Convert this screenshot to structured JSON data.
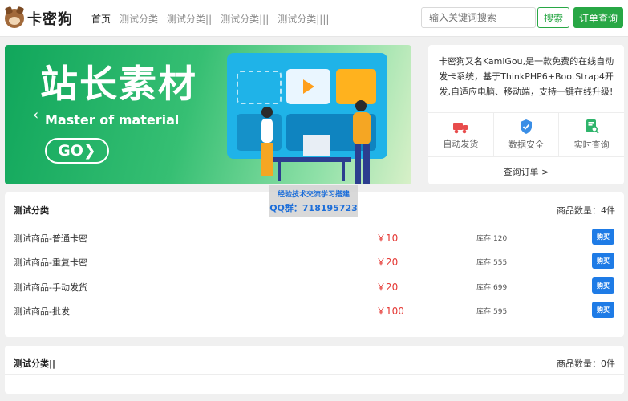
{
  "header": {
    "logo_text": "卡密狗",
    "nav": [
      {
        "label": "首页",
        "active": true
      },
      {
        "label": "测试分类",
        "active": false
      },
      {
        "label": "测试分类||",
        "active": false
      },
      {
        "label": "测试分类|||",
        "active": false
      },
      {
        "label": "测试分类||||",
        "active": false
      }
    ],
    "search_placeholder": "输入关键词搜索",
    "search_label": "搜索",
    "order_label": "订单查询"
  },
  "banner": {
    "title": "站长素材",
    "subtitle": "Master of material",
    "go_label": "GO",
    "prev_icon": "chevron-left-icon",
    "next_icon": "chevron-right-icon"
  },
  "side": {
    "description": "卡密狗又名KamiGou,是一款免费的在线自动发卡系统，基于ThinkPHP6+BootStrap4开发,自适应电脑、移动端，支持一键在线升级!",
    "features": [
      {
        "label": "自动发货",
        "icon": "truck-icon",
        "color": "#e84c4c"
      },
      {
        "label": "数据安全",
        "icon": "shield-icon",
        "color": "#3a8ee6"
      },
      {
        "label": "实时查询",
        "icon": "search-doc-icon",
        "color": "#2fb46b"
      }
    ],
    "query_link": "查询订单 >"
  },
  "categories": [
    {
      "title": "测试分类",
      "count_label": "商品数量：4件",
      "products": [
        {
          "name": "测试商品-普通卡密",
          "price": "￥10",
          "stock": "库存:120",
          "buy": "购买"
        },
        {
          "name": "测试商品-重复卡密",
          "price": "￥20",
          "stock": "库存:555",
          "buy": "购买"
        },
        {
          "name": "测试商品-手动发货",
          "price": "￥20",
          "stock": "库存:699",
          "buy": "购买"
        },
        {
          "name": "测试商品-批发",
          "price": "￥100",
          "stock": "库存:595",
          "buy": "购买"
        }
      ]
    },
    {
      "title": "测试分类||",
      "count_label": "商品数量：0件",
      "products": []
    }
  ],
  "watermark": {
    "line1": "经验技术交流学习搭建",
    "line2": "QQ群：718195723"
  },
  "colors": {
    "brand_green": "#28a745",
    "price_red": "#e53935",
    "buy_blue": "#1e7be6"
  }
}
